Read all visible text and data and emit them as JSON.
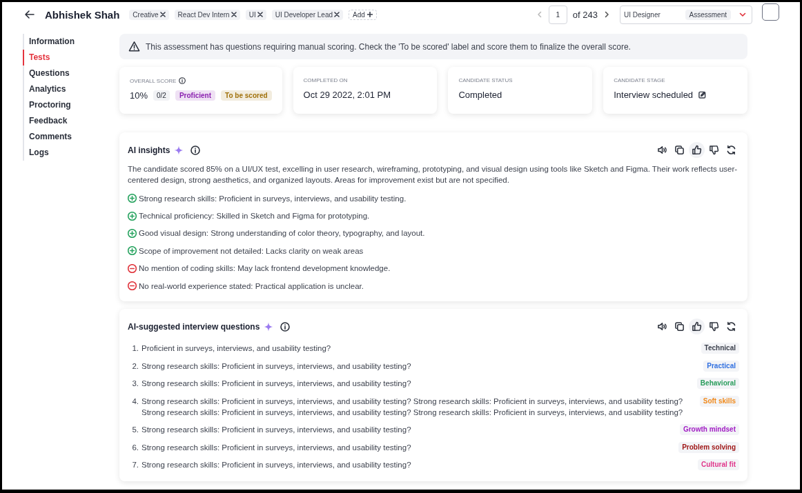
{
  "header": {
    "name": "Abhishek Shah",
    "tags": [
      {
        "label": "Creative"
      },
      {
        "label": "React Dev Intern"
      },
      {
        "label": "UI"
      },
      {
        "label": "UI Developer Lead"
      }
    ],
    "add_label": "Add",
    "pagination": {
      "current": "1",
      "total": "of 243"
    },
    "role_select": {
      "value": "UI Designer",
      "chip": "Assessment"
    }
  },
  "sidebar": {
    "items": [
      {
        "label": "Information",
        "selected": false
      },
      {
        "label": "Tests",
        "selected": true
      },
      {
        "label": "Questions",
        "selected": false
      },
      {
        "label": "Analytics",
        "selected": false
      },
      {
        "label": "Proctoring",
        "selected": false
      },
      {
        "label": "Feedback",
        "selected": false
      },
      {
        "label": "Comments",
        "selected": false
      },
      {
        "label": "Logs",
        "selected": false
      }
    ]
  },
  "alert": {
    "text": "This assessment has questions requiring manual scoring. Check the 'To be scored' label and score them to finalize the overall score."
  },
  "stats": [
    {
      "kind": "score",
      "label": "OVERALL SCORE",
      "value": "10%",
      "fraction": "0/2",
      "badges": [
        {
          "label": "Proficient",
          "color": "#8a1fb0"
        },
        {
          "label": "To be scored",
          "color": "#a0700a"
        }
      ]
    },
    {
      "kind": "plain",
      "label": "COMPLETED ON",
      "value": "Oct 29 2022, 2:01 PM"
    },
    {
      "kind": "plain",
      "label": "CANDIDATE STATUS",
      "value": "Completed"
    },
    {
      "kind": "editable",
      "label": "CANDIDATE STAGE",
      "value": "Interview scheduled"
    }
  ],
  "insights": {
    "title": "AI insights",
    "liked": true,
    "summary": "The candidate scored 85% on a UI/UX test, excelling in user research, wireframing, prototyping, and visual design using tools like Sketch and Figma. Their work reflects user-centered design, strong aesthetics, and organized layouts. Areas for improvement exist but are not specified.",
    "points": [
      {
        "kind": "pro",
        "text": "Strong research skills: Proficient in surveys, interviews, and usability testing."
      },
      {
        "kind": "pro",
        "text": "Technical proficiency: Skilled in Sketch and Figma for prototyping."
      },
      {
        "kind": "pro",
        "text": "Good visual design: Strong understanding of color theory, typography, and layout."
      },
      {
        "kind": "pro",
        "text": "Scope of improvement not detailed: Lacks clarity on weak areas"
      },
      {
        "kind": "con",
        "text": "No mention of coding skills: May lack frontend development knowledge."
      },
      {
        "kind": "con",
        "text": "No real-world experience stated: Practical application is unclear."
      }
    ]
  },
  "questions": {
    "title": "AI-suggested interview questions",
    "liked": true,
    "items": [
      {
        "number": "1.",
        "text": "Proficient in surveys, interviews, and usability testing?",
        "tag": "Technical",
        "color": "#3a3f4b"
      },
      {
        "number": "2.",
        "text": "Strong research skills: Proficient in surveys, interviews, and usability testing?",
        "tag": "Practical",
        "color": "#2f6fe0"
      },
      {
        "number": "3.",
        "text": "Strong research skills: Proficient in surveys, interviews, and usability testing?",
        "tag": "Behavioral",
        "color": "#2a9d5c"
      },
      {
        "number": "4.",
        "text": "Strong research skills: Proficient in surveys, interviews, and usability testing? Strong research skills: Proficient in surveys, interviews, and usability testing? Strong research skills: Proficient in surveys, interviews, and usability testing? Strong research skills: Proficient in surveys, interviews, and usability testing?",
        "tag": "Soft skills",
        "color": "#f08a1c"
      },
      {
        "number": "5.",
        "text": "Strong research skills: Proficient in surveys, interviews, and usability testing?",
        "tag": "Growth mindset",
        "color": "#a21cc4"
      },
      {
        "number": "6.",
        "text": "Strong research skills: Proficient in surveys, interviews, and usability testing?",
        "tag": "Problem solving",
        "color": "#a01818"
      },
      {
        "number": "7.",
        "text": "Strong research skills: Proficient in surveys, interviews, and usability testing?",
        "tag": "Cultural fit",
        "color": "#e0358a"
      }
    ]
  }
}
